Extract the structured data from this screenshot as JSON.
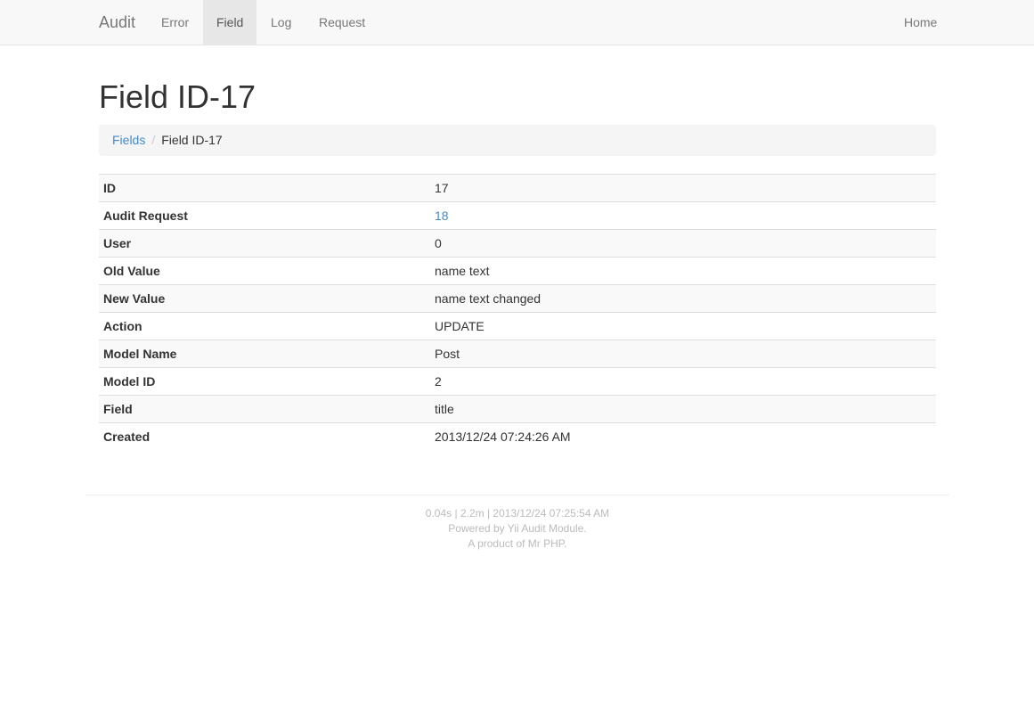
{
  "navbar": {
    "brand": "Audit",
    "items": [
      {
        "label": "Error",
        "active": false
      },
      {
        "label": "Field",
        "active": true
      },
      {
        "label": "Log",
        "active": false
      },
      {
        "label": "Request",
        "active": false
      }
    ],
    "right": {
      "label": "Home"
    }
  },
  "page": {
    "title": "Field ID-17"
  },
  "breadcrumb": {
    "parent": "Fields",
    "separator": "/",
    "current": "Field ID-17"
  },
  "details": [
    {
      "label": "ID",
      "value": "17"
    },
    {
      "label": "Audit Request",
      "value": "18"
    },
    {
      "label": "User",
      "value": "0"
    },
    {
      "label": "Old Value",
      "value": "name text"
    },
    {
      "label": "New Value",
      "value": "name text changed"
    },
    {
      "label": "Action",
      "value": "UPDATE"
    },
    {
      "label": "Model Name",
      "value": "Post"
    },
    {
      "label": "Model ID",
      "value": "2"
    },
    {
      "label": "Field",
      "value": "title"
    },
    {
      "label": "Created",
      "value": "2013/12/24 07:24:26 AM"
    }
  ],
  "footer": {
    "stats": "0.04s | 2.2m | 2013/12/24 07:25:54 AM",
    "powered_prefix": "Powered by ",
    "powered_link": "Yii Audit Module",
    "powered_suffix": ".",
    "product_prefix": "A product of ",
    "product_link": "Mr PHP",
    "product_suffix": "."
  },
  "colors": {
    "link": "#428bca",
    "navbar_bg": "#f8f8f8",
    "nav_active_bg": "#e7e7e7",
    "footer_text": "#bbbbbb"
  }
}
